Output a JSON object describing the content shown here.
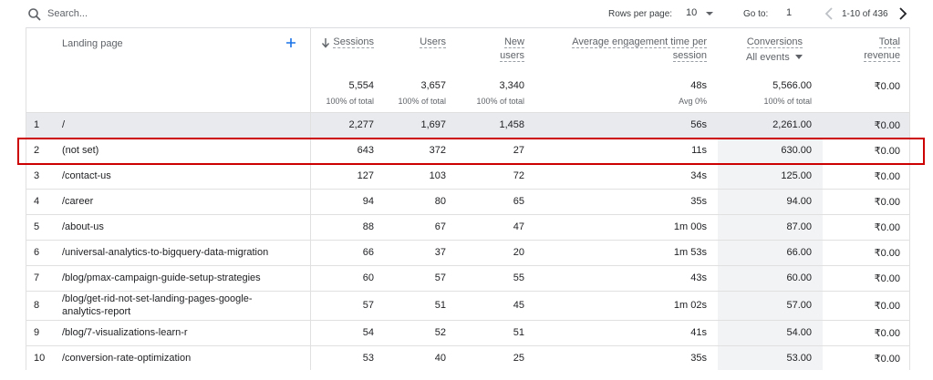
{
  "toolbar": {
    "search_placeholder": "Search...",
    "rows_per_page_label": "Rows per page:",
    "rows_per_page_value": "10",
    "goto_label": "Go to:",
    "goto_value": "1",
    "page_range": "1-10 of 436"
  },
  "headers": {
    "landing_page": "Landing page",
    "sessions": "Sessions",
    "users": "Users",
    "new_users_1": "New",
    "new_users_2": "users",
    "avg_eng_1": "Average engagement time per",
    "avg_eng_2": "session",
    "conversions": "Conversions",
    "conversions_filter": "All events",
    "revenue_1": "Total",
    "revenue_2": "revenue"
  },
  "totals": {
    "sessions": "5,554",
    "sessions_sub": "100% of total",
    "users": "3,657",
    "users_sub": "100% of total",
    "new_users": "3,340",
    "new_users_sub": "100% of total",
    "avg_eng": "48s",
    "avg_eng_sub": "Avg 0%",
    "conversions": "5,566.00",
    "conversions_sub": "100% of total",
    "revenue": "₹0.00"
  },
  "rows": [
    {
      "n": "1",
      "page": "/",
      "page2": "",
      "sessions": "2,277",
      "users": "1,697",
      "new_users": "1,458",
      "eng": "56s",
      "conv": "2,261.00",
      "rev": "₹0.00"
    },
    {
      "n": "2",
      "page": "(not set)",
      "page2": "",
      "sessions": "643",
      "users": "372",
      "new_users": "27",
      "eng": "11s",
      "conv": "630.00",
      "rev": "₹0.00"
    },
    {
      "n": "3",
      "page": "/contact-us",
      "page2": "",
      "sessions": "127",
      "users": "103",
      "new_users": "72",
      "eng": "34s",
      "conv": "125.00",
      "rev": "₹0.00"
    },
    {
      "n": "4",
      "page": "/career",
      "page2": "",
      "sessions": "94",
      "users": "80",
      "new_users": "65",
      "eng": "35s",
      "conv": "94.00",
      "rev": "₹0.00"
    },
    {
      "n": "5",
      "page": "/about-us",
      "page2": "",
      "sessions": "88",
      "users": "67",
      "new_users": "47",
      "eng": "1m 00s",
      "conv": "87.00",
      "rev": "₹0.00"
    },
    {
      "n": "6",
      "page": "/universal-analytics-to-bigquery-data-migration",
      "page2": "",
      "sessions": "66",
      "users": "37",
      "new_users": "20",
      "eng": "1m 53s",
      "conv": "66.00",
      "rev": "₹0.00"
    },
    {
      "n": "7",
      "page": "/blog/pmax-campaign-guide-setup-strategies",
      "page2": "",
      "sessions": "60",
      "users": "57",
      "new_users": "55",
      "eng": "43s",
      "conv": "60.00",
      "rev": "₹0.00"
    },
    {
      "n": "8",
      "page": "/blog/get-rid-not-set-landing-pages-google-",
      "page2": "analytics-report",
      "sessions": "57",
      "users": "51",
      "new_users": "45",
      "eng": "1m 02s",
      "conv": "57.00",
      "rev": "₹0.00"
    },
    {
      "n": "9",
      "page": "/blog/7-visualizations-learn-r",
      "page2": "",
      "sessions": "54",
      "users": "52",
      "new_users": "51",
      "eng": "41s",
      "conv": "54.00",
      "rev": "₹0.00"
    },
    {
      "n": "10",
      "page": "/conversion-rate-optimization",
      "page2": "",
      "sessions": "53",
      "users": "40",
      "new_users": "25",
      "eng": "35s",
      "conv": "53.00",
      "rev": "₹0.00"
    }
  ],
  "colors": {
    "highlight": "#cc0000",
    "accent": "#1a73e8"
  },
  "icons": [
    "search-icon",
    "caret-down-icon",
    "chevron-left-icon",
    "chevron-right-icon",
    "add-icon",
    "sort-down-icon"
  ]
}
